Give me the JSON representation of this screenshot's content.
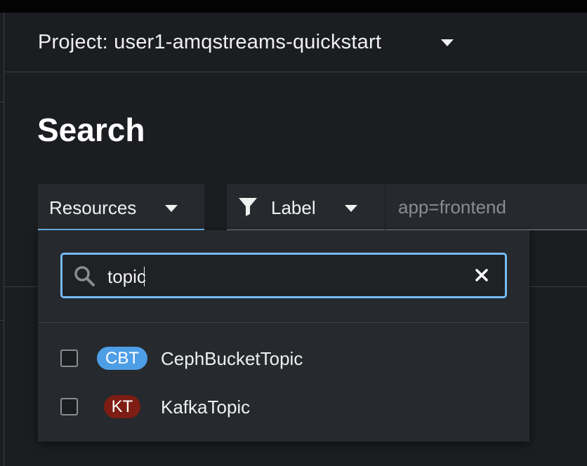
{
  "project": {
    "label": "Project: user1-amqstreams-quickstart"
  },
  "page": {
    "title": "Search"
  },
  "toolbar": {
    "resources_label": "Resources",
    "label_filter_label": "Label",
    "label_input_placeholder": "app=frontend"
  },
  "resource_menu": {
    "search_value": "topic",
    "items": [
      {
        "badge": "CBT",
        "badge_color": "#4e9ee6",
        "label": "CephBucketTopic",
        "checked": false
      },
      {
        "badge": "KT",
        "badge_color": "#7d1d13",
        "label": "KafkaTopic",
        "checked": false
      }
    ]
  },
  "colors": {
    "accent": "#73bcf7",
    "background": "#1b1d21",
    "surface": "#26292d"
  }
}
